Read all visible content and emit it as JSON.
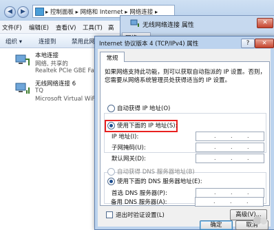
{
  "explorer": {
    "address_path": "▸  控制面板  ▸  网络和 Internet  ▸  网络连接  ▸",
    "menu": [
      "文件(F)",
      "编辑(E)",
      "查看(V)",
      "工具(T)",
      "高"
    ],
    "toolbar": [
      "组织 ▾",
      "连接到",
      "禁用此网"
    ],
    "connections": [
      {
        "name": "本地连接",
        "status": "网络, 共享的",
        "adapter": "Realtek PCIe GBE Fami"
      },
      {
        "name": "无线网络连接 6",
        "status": "TQ",
        "adapter": "Microsoft Virtual WiFi"
      }
    ]
  },
  "props_window": {
    "title": "无线网络连接 属性",
    "close_label": "✕",
    "tab_label": "网络"
  },
  "dialog": {
    "title": "Internet 协议版本 4 (TCP/IPv4) 属性",
    "help_label": "?",
    "close_label": "✕",
    "tab_general": "常规",
    "description": [
      "如果网络支持此功能，则可以获取自动指派的 IP 设置。否则，",
      "您需要从网络系统管理员处获得适当的 IP 设置。"
    ],
    "radio_auto_ip": "自动获得 IP 地址(O)",
    "radio_manual_ip": "使用下面的 IP 地址(S):",
    "ip_fields": [
      "IP 地址(I):",
      "子网掩码(U):",
      "默认网关(D):"
    ],
    "radio_auto_dns": "自动获得 DNS 服务器地址(B)",
    "radio_manual_dns": "使用下面的 DNS 服务器地址(E):",
    "dns_fields": [
      "首选 DNS 服务器(P):",
      "备用 DNS 服务器(A):"
    ],
    "validate_label": "退出时验证设置(L)",
    "advanced_label": "高级(V)...",
    "ok_label": "确定",
    "cancel_label": "取消",
    "highlight_color": "#e8201f"
  }
}
